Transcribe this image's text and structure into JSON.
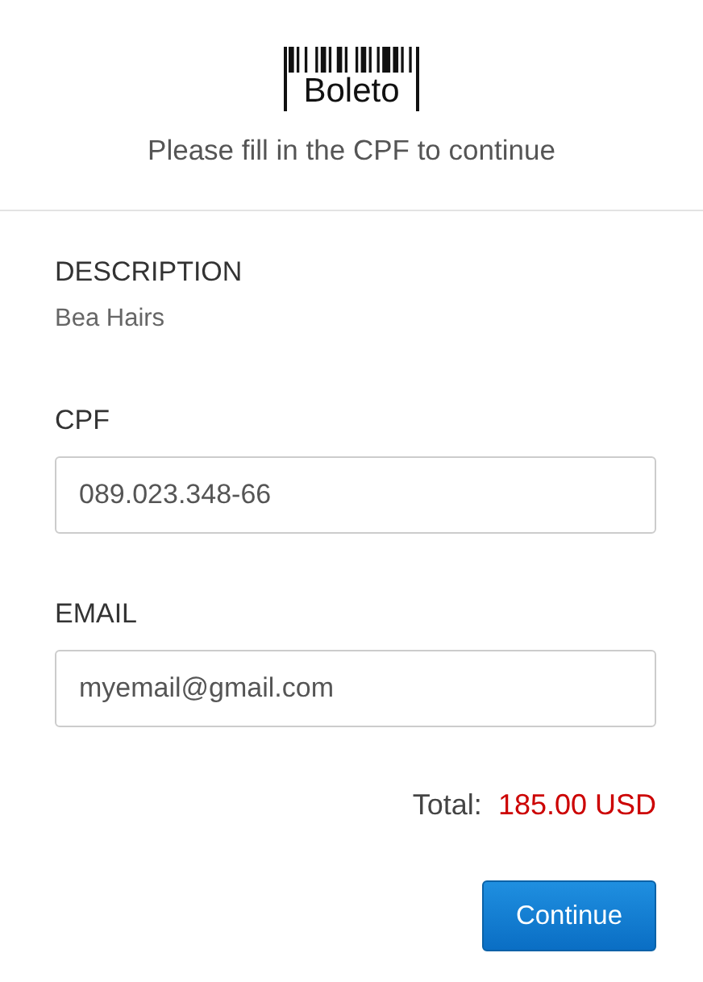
{
  "header": {
    "logo_text": "Boleto",
    "subtitle": "Please fill in the CPF to continue"
  },
  "description": {
    "label": "DESCRIPTION",
    "value": "Bea Hairs"
  },
  "fields": [
    {
      "label": "CPF",
      "value": "089.023.348-66"
    },
    {
      "label": "EMAIL",
      "value": "myemail@gmail.com"
    }
  ],
  "total": {
    "label": "Total:",
    "amount": "185.00 USD"
  },
  "buttons": [
    "Continue"
  ]
}
